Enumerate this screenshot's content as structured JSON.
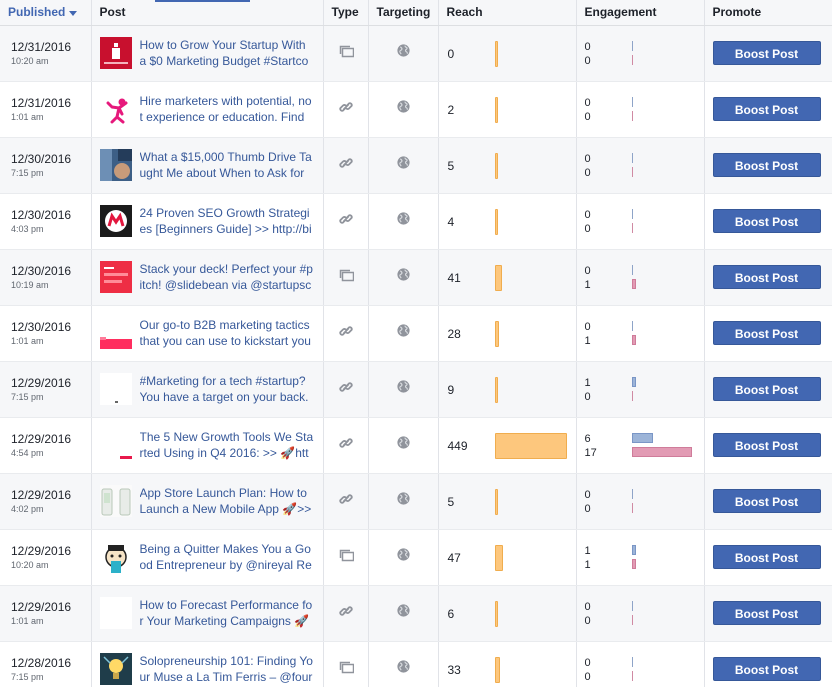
{
  "columns": {
    "published": "Published",
    "post": "Post",
    "type": "Type",
    "targeting": "Targeting",
    "reach": "Reach",
    "engagement": "Engagement",
    "promote": "Promote"
  },
  "colors": {
    "accent": "#4267b2",
    "reach_bar": "#fdc77d",
    "clicks_bar": "#9cb4d8",
    "reactions_bar": "#e29bb4"
  },
  "reach_max": 449,
  "engagement_max": 17,
  "rows": [
    {
      "date": "12/31/2016",
      "time": "10:20 am",
      "text": "How to Grow Your Startup With a $0 Marketing Budget #Startco",
      "type": "photo-icon",
      "reach": "0",
      "reach_value": 0,
      "eng1": "0",
      "eng2": "0",
      "eng1_value": 0,
      "eng2_value": 0,
      "button": "Boost Post",
      "thumb": "red-book"
    },
    {
      "date": "12/31/2016",
      "time": "1:01 am",
      "text": "Hire marketers with potential, not experience or education. Find o",
      "type": "link-icon",
      "reach": "2",
      "reach_value": 2,
      "eng1": "0",
      "eng2": "0",
      "eng1_value": 0,
      "eng2_value": 0,
      "button": "Boost Post",
      "thumb": "pink-person"
    },
    {
      "date": "12/30/2016",
      "time": "7:15 pm",
      "text": "What a $15,000 Thumb Drive Taught Me about When to Ask for",
      "type": "link-icon",
      "reach": "5",
      "reach_value": 5,
      "eng1": "0",
      "eng2": "0",
      "eng1_value": 0,
      "eng2_value": 0,
      "button": "Boost Post",
      "thumb": "blue-photo"
    },
    {
      "date": "12/30/2016",
      "time": "4:03 pm",
      "text": "24 Proven SEO Growth Strategies [Beginners Guide] >> http://bi",
      "type": "link-icon",
      "reach": "4",
      "reach_value": 4,
      "eng1": "0",
      "eng2": "0",
      "eng1_value": 0,
      "eng2_value": 0,
      "button": "Boost Post",
      "thumb": "dark-logo"
    },
    {
      "date": "12/30/2016",
      "time": "10:19 am",
      "text": "Stack your deck! Perfect your #pitch! @slidebean via @startupsc",
      "type": "photo-icon",
      "reach": "41",
      "reach_value": 41,
      "eng1": "0",
      "eng2": "1",
      "eng1_value": 0,
      "eng2_value": 1,
      "button": "Boost Post",
      "thumb": "red-slide"
    },
    {
      "date": "12/30/2016",
      "time": "1:01 am",
      "text": "Our go-to B2B marketing tactics that you can use to kickstart you",
      "type": "link-icon",
      "reach": "28",
      "reach_value": 28,
      "eng1": "0",
      "eng2": "1",
      "eng1_value": 0,
      "eng2_value": 1,
      "button": "Boost Post",
      "thumb": "pink-strip"
    },
    {
      "date": "12/29/2016",
      "time": "7:15 pm",
      "text": "#Marketing for a tech #startup? You have a target on your back.",
      "type": "link-icon",
      "reach": "9",
      "reach_value": 9,
      "eng1": "1",
      "eng2": "0",
      "eng1_value": 1,
      "eng2_value": 0,
      "button": "Boost Post",
      "thumb": "white-dot"
    },
    {
      "date": "12/29/2016",
      "time": "4:54 pm",
      "text": "The 5 New Growth Tools We Started Using in Q4 2016: >> 🚀htt",
      "type": "link-icon",
      "reach": "449",
      "reach_value": 449,
      "eng1": "6",
      "eng2": "17",
      "eng1_value": 6,
      "eng2_value": 17,
      "button": "Boost Post",
      "thumb": "red-line"
    },
    {
      "date": "12/29/2016",
      "time": "4:02 pm",
      "text": "App Store Launch Plan: How to Launch a New Mobile App 🚀>>",
      "type": "link-icon",
      "reach": "5",
      "reach_value": 5,
      "eng1": "0",
      "eng2": "0",
      "eng1_value": 0,
      "eng2_value": 0,
      "button": "Boost Post",
      "thumb": "phones"
    },
    {
      "date": "12/29/2016",
      "time": "10:20 am",
      "text": "Being a Quitter Makes You a Good Entrepreneur by @nireyal Re",
      "type": "photo-icon",
      "reach": "47",
      "reach_value": 47,
      "eng1": "1",
      "eng2": "1",
      "eng1_value": 1,
      "eng2_value": 1,
      "button": "Boost Post",
      "thumb": "cartoon"
    },
    {
      "date": "12/29/2016",
      "time": "1:01 am",
      "text": "How to Forecast Performance for Your Marketing Campaigns 🚀",
      "type": "link-icon",
      "reach": "6",
      "reach_value": 6,
      "eng1": "0",
      "eng2": "0",
      "eng1_value": 0,
      "eng2_value": 0,
      "button": "Boost Post",
      "thumb": "blank"
    },
    {
      "date": "12/28/2016",
      "time": "7:15 pm",
      "text": "Solopreneurship 101: Finding Your Muse a La Tim Ferris – @four",
      "type": "photo-icon",
      "reach": "33",
      "reach_value": 33,
      "eng1": "0",
      "eng2": "0",
      "eng1_value": 0,
      "eng2_value": 0,
      "button": "Boost Post",
      "thumb": "bulb"
    }
  ]
}
